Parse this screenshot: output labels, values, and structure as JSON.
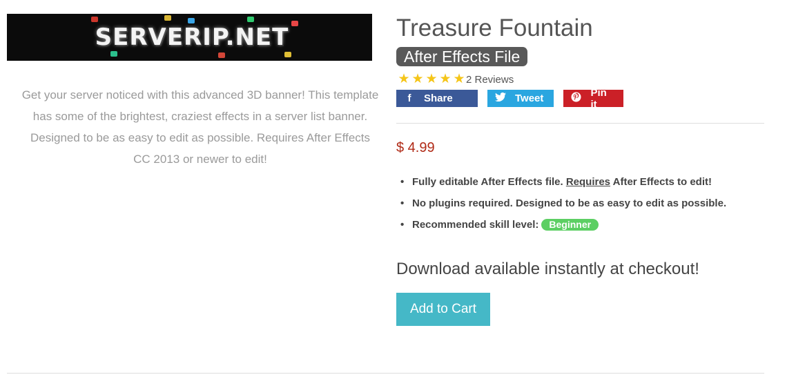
{
  "banner": {
    "wordmark": "SERVERIP.NET"
  },
  "product": {
    "description": "Get your server noticed with this advanced 3D banner! This template has some of the brightest, craziest effects in a server list banner. Designed to be as easy to edit as possible. Requires After Effects CC 2013 or newer to edit!",
    "title": "Treasure Fountain",
    "type_badge": "After Effects File",
    "rating": {
      "stars": 5,
      "star_glyph": "★",
      "reviews_label": "2 Reviews",
      "star_color": "#f5c518"
    },
    "price": "$ 4.99",
    "price_color": "#b02a16",
    "features": {
      "item1_part1": "Fully editable After Effects file. ",
      "item1_link": "Requires",
      "item1_part2": " After Effects to edit!",
      "item2": "No plugins required. Designed to be as easy to edit as possible.",
      "item3_label": "Recommended skill level: ",
      "item3_badge": "Beginner",
      "badge_color": "#5ccf63"
    },
    "download_note": "Download available instantly at checkout!",
    "add_to_cart_label": "Add to Cart",
    "add_to_cart_color": "#45b8c7"
  },
  "share": {
    "facebook": {
      "label": "Share",
      "icon": "facebook-icon",
      "glyph": "f",
      "color": "#3b5998"
    },
    "twitter": {
      "label": "Tweet",
      "icon": "twitter-icon",
      "glyph": "🐦",
      "color": "#2aa6e0"
    },
    "pinterest": {
      "label": "Pin it",
      "icon": "pinterest-icon",
      "glyph": "℗",
      "color": "#cb2027"
    }
  }
}
